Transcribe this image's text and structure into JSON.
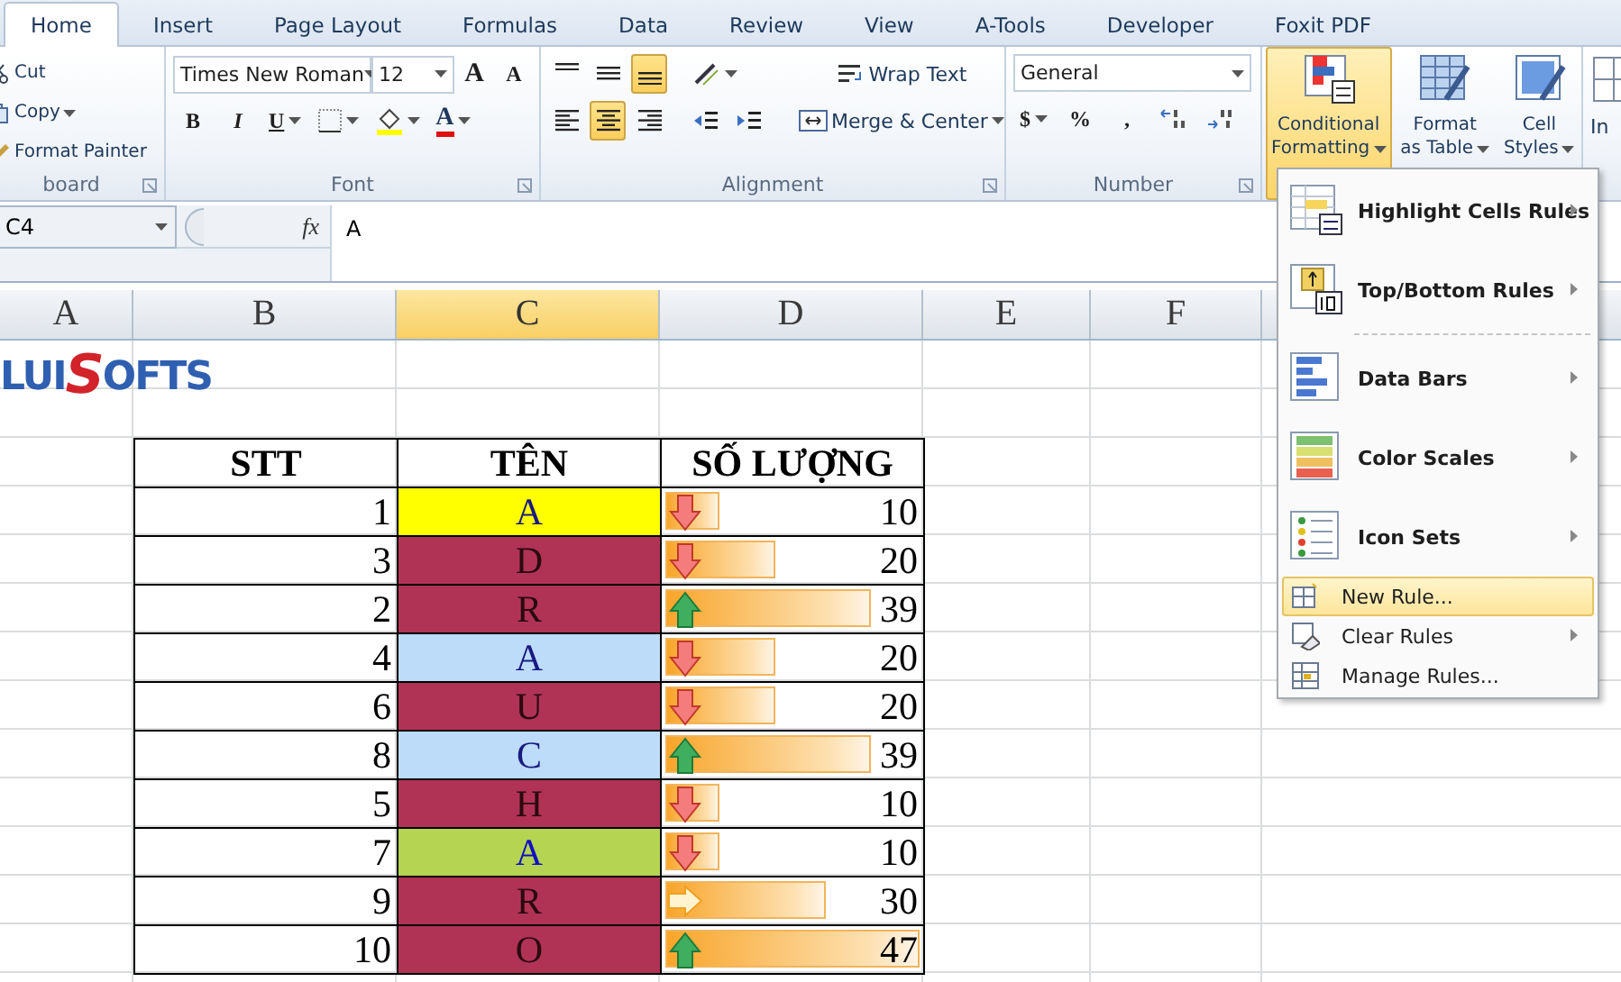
{
  "tabs": [
    {
      "label": "Home",
      "selected": true
    },
    {
      "label": "Insert",
      "selected": false
    },
    {
      "label": "Page Layout",
      "selected": false
    },
    {
      "label": "Formulas",
      "selected": false
    },
    {
      "label": "Data",
      "selected": false
    },
    {
      "label": "Review",
      "selected": false
    },
    {
      "label": "View",
      "selected": false
    },
    {
      "label": "A-Tools",
      "selected": false
    },
    {
      "label": "Developer",
      "selected": false
    },
    {
      "label": "Foxit PDF",
      "selected": false
    }
  ],
  "clipboard": {
    "items": [
      {
        "label": "Cut",
        "kind": "cut",
        "dropdown": false
      },
      {
        "label": "Copy",
        "kind": "copy",
        "dropdown": true
      },
      {
        "label": "Format Painter",
        "kind": "painter",
        "dropdown": false
      }
    ],
    "group_label": "board"
  },
  "font": {
    "name": "Times New Roman",
    "size": "12",
    "grow": "A",
    "shrink": "A",
    "styles": [
      "B",
      "I",
      "U"
    ],
    "color_button": "A",
    "group_label": "Font"
  },
  "alignment": {
    "vertical": [
      {
        "kind": "top",
        "selected": false
      },
      {
        "kind": "middle",
        "selected": false
      },
      {
        "kind": "bottom",
        "selected": true
      }
    ],
    "horizontal": [
      {
        "kind": "left",
        "selected": false
      },
      {
        "kind": "center",
        "selected": true
      },
      {
        "kind": "right",
        "selected": false
      }
    ],
    "wrap": "Wrap Text",
    "merge": "Merge & Center",
    "group_label": "Alignment"
  },
  "number": {
    "format": "General",
    "symbols": [
      "$",
      "%",
      ","
    ],
    "group_label": "Number"
  },
  "styles": [
    {
      "line1": "Conditional",
      "line2": "Formatting",
      "kind": "conditional",
      "selected": true
    },
    {
      "line1": "Format",
      "line2": "as Table",
      "kind": "table",
      "selected": false
    },
    {
      "line1": "Cell",
      "line2": "Styles",
      "kind": "cell",
      "selected": false
    }
  ],
  "cells_group": {
    "label": "In"
  },
  "formula_bar": {
    "name_box": "C4",
    "function_label": "fx",
    "value": "A"
  },
  "columns": [
    {
      "label": "A",
      "selected": false
    },
    {
      "label": "B",
      "selected": false
    },
    {
      "label": "C",
      "selected": true
    },
    {
      "label": "D",
      "selected": false
    },
    {
      "label": "E",
      "selected": false
    },
    {
      "label": "F",
      "selected": false
    }
  ],
  "logo": [
    "LUI",
    "S",
    "OFTS"
  ],
  "table": {
    "columns": [
      "STT",
      "TÊN",
      "SỐ LƯỢNG"
    ],
    "rows": [
      {
        "stt": "1",
        "name": "A",
        "color": "#ffff00",
        "quantity": "10",
        "kind": "down",
        "level": 0.21
      },
      {
        "stt": "3",
        "name": "D",
        "color": "#b03355",
        "quantity": "20",
        "kind": "down",
        "level": 0.43
      },
      {
        "stt": "2",
        "name": "R",
        "color": "#b03355",
        "quantity": "39",
        "kind": "up",
        "level": 0.81
      },
      {
        "stt": "4",
        "name": "A",
        "color": "#bcdcfa",
        "quantity": "20",
        "kind": "down",
        "level": 0.43
      },
      {
        "stt": "6",
        "name": "U",
        "color": "#b03355",
        "quantity": "20",
        "kind": "down",
        "level": 0.43
      },
      {
        "stt": "8",
        "name": "C",
        "color": "#bcdcfa",
        "quantity": "39",
        "kind": "up",
        "level": 0.81
      },
      {
        "stt": "5",
        "name": "H",
        "color": "#b03355",
        "quantity": "10",
        "kind": "down",
        "level": 0.21
      },
      {
        "stt": "7",
        "name": "A",
        "color": "#b5d452",
        "quantity": "10",
        "kind": "down",
        "level": 0.21
      },
      {
        "stt": "9",
        "name": "R",
        "color": "#b03355",
        "quantity": "30",
        "kind": "right",
        "level": 0.63
      },
      {
        "stt": "10",
        "name": "O",
        "color": "#b03355",
        "quantity": "47",
        "kind": "up",
        "level": 1
      }
    ]
  },
  "menu": {
    "sections": [
      {
        "items": [
          {
            "label": "Highlight Cells Rules",
            "kind": "highlight",
            "submenu": true,
            "selected": false
          },
          {
            "label": "Top/Bottom Rules",
            "kind": "topbottom",
            "submenu": true,
            "selected": false
          }
        ]
      },
      {
        "items": [
          {
            "label": "Data Bars",
            "kind": "databars",
            "submenu": true,
            "selected": false
          },
          {
            "label": "Color Scales",
            "kind": "colorscales",
            "submenu": true,
            "selected": false
          },
          {
            "label": "Icon Sets",
            "kind": "iconsets",
            "submenu": true,
            "selected": false
          },
          {
            "label": "New Rule...",
            "kind": "newrule",
            "submenu": false,
            "selected": true
          },
          {
            "label": "Clear Rules",
            "kind": "clearrules",
            "submenu": true,
            "selected": false
          },
          {
            "label": "Manage Rules...",
            "kind": "managerules",
            "submenu": false,
            "selected": false
          }
        ]
      }
    ]
  }
}
